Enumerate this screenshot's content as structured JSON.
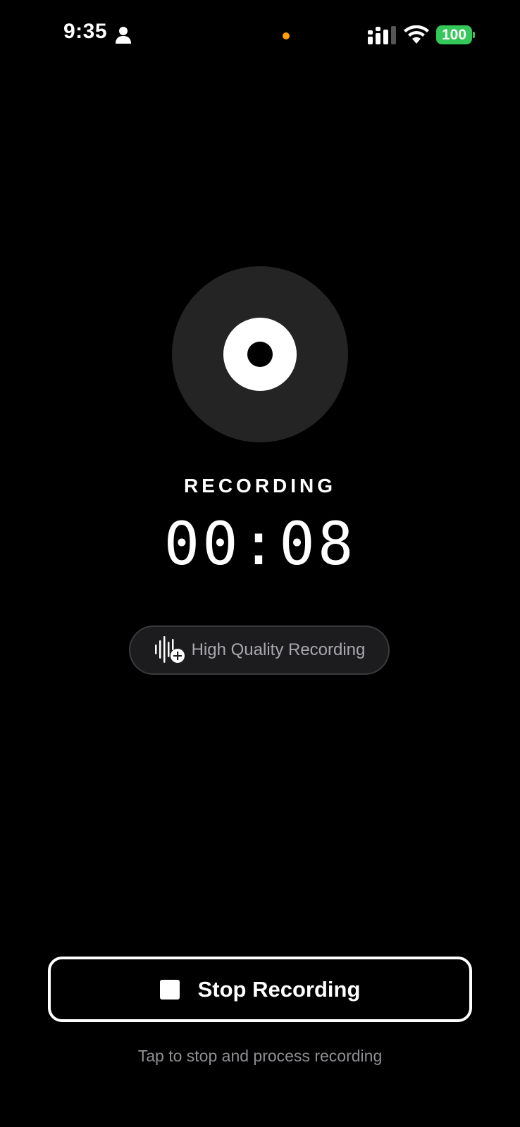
{
  "status_bar": {
    "time": "9:35",
    "battery": "100",
    "icons": [
      "person-icon",
      "signal-icon",
      "wifi-icon",
      "battery-icon"
    ],
    "mic_indicator_color": "#ff9f0a",
    "battery_color": "#34c759"
  },
  "recorder": {
    "disc_icon": "record-disc-icon",
    "status_label": "RECORDING",
    "elapsed": "00:08"
  },
  "quality": {
    "icon": "waveform-plus-icon",
    "label": "High Quality Recording"
  },
  "stop": {
    "icon": "stop-square-icon",
    "label": "Stop Recording"
  },
  "hint": "Tap to stop and process recording",
  "colors": {
    "background": "#000000",
    "disc": "#242424",
    "pill": "#1c1c1e",
    "hint_text": "#8e8e93"
  }
}
